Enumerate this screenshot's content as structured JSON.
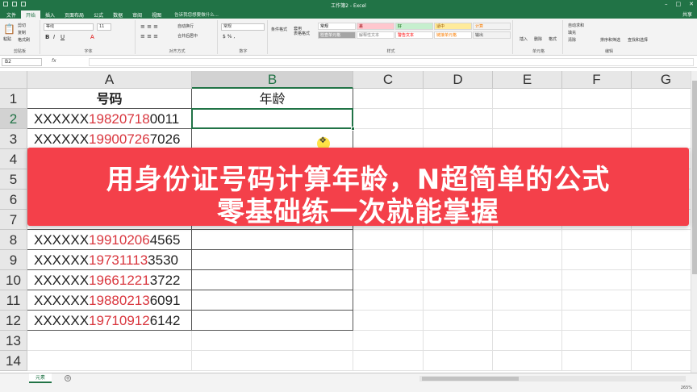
{
  "window": {
    "title": "工作簿2 - Excel",
    "share": "共享"
  },
  "tabs": [
    "文件",
    "开始",
    "插入",
    "页面布局",
    "公式",
    "数据",
    "审阅",
    "视图"
  ],
  "active_tab": "开始",
  "tellme": "告诉我您想要做什么...",
  "ribbon": {
    "clipboard": {
      "label": "剪贴板",
      "paste": "粘贴",
      "cut": "剪切",
      "copy": "复制",
      "format_painter": "格式刷"
    },
    "font": {
      "label": "字体",
      "font_name": "等线",
      "font_size": "11"
    },
    "alignment": {
      "label": "对齐方式",
      "wrap": "自动换行",
      "merge": "合并后居中"
    },
    "number": {
      "label": "数字",
      "format": "常规"
    },
    "styles": {
      "label": "样式",
      "conditional": "条件格式",
      "table": "套用\n表格格式",
      "cells": [
        {
          "text": "常规",
          "bg": "#ffffff",
          "fg": "#000000"
        },
        {
          "text": "差",
          "bg": "#ffc7ce",
          "fg": "#9c0006"
        },
        {
          "text": "好",
          "bg": "#c6efce",
          "fg": "#006100"
        },
        {
          "text": "适中",
          "bg": "#ffeb9c",
          "fg": "#9c5700"
        },
        {
          "text": "计算",
          "bg": "#f2f2f2",
          "fg": "#fa7d00"
        },
        {
          "text": "检查单元格",
          "bg": "#a5a5a5",
          "fg": "#ffffff"
        },
        {
          "text": "解释性文本",
          "bg": "#ffffff",
          "fg": "#7f7f7f"
        },
        {
          "text": "警告文本",
          "bg": "#ffffff",
          "fg": "#ff0000"
        },
        {
          "text": "链接单元格",
          "bg": "#ffffff",
          "fg": "#fa7d00"
        },
        {
          "text": "输出",
          "bg": "#f2f2f2",
          "fg": "#3f3f3f"
        }
      ]
    },
    "cells_group": {
      "label": "单元格",
      "insert": "插入",
      "delete": "删除",
      "format": "格式"
    },
    "editing": {
      "label": "编辑",
      "autosum": "自动求和",
      "fill": "填充",
      "clear": "清除",
      "sort": "排序和筛选",
      "find": "查找和选择"
    }
  },
  "formula_bar": {
    "name_box": "B2",
    "fx": "fx"
  },
  "columns": [
    "A",
    "B",
    "C",
    "D",
    "E",
    "F",
    "G"
  ],
  "rows": [
    "1",
    "2",
    "3",
    "4",
    "5",
    "6",
    "7",
    "8",
    "9",
    "10",
    "11",
    "12",
    "13",
    "14"
  ],
  "selected_cell": "B2",
  "header": {
    "a1": "号码",
    "b1": "年龄"
  },
  "id_rows": [
    {
      "row": "2",
      "prefix": "XXXXXX",
      "birth": "19820718",
      "suffix": "0011"
    },
    {
      "row": "3",
      "prefix": "XXXXXX",
      "birth": "19900726",
      "suffix": "7026"
    },
    {
      "row": "8",
      "prefix": "XXXXXX",
      "birth": "19910206",
      "suffix": "4565"
    },
    {
      "row": "9",
      "prefix": "XXXXXX",
      "birth": "19731113",
      "suffix": "3530"
    },
    {
      "row": "10",
      "prefix": "XXXXXX",
      "birth": "19661221",
      "suffix": "3722"
    },
    {
      "row": "11",
      "prefix": "XXXXXX",
      "birth": "19880213",
      "suffix": "6091"
    },
    {
      "row": "12",
      "prefix": "XXXXXX",
      "birth": "19710912",
      "suffix": "6142"
    }
  ],
  "banner": {
    "line1": "用身份证号码计算年龄，N超简单的公式",
    "line2": "零基础练一次就能掌握",
    "color": "#f4404a"
  },
  "sheet_tab": "元素",
  "status": {
    "zoom": "265%"
  }
}
